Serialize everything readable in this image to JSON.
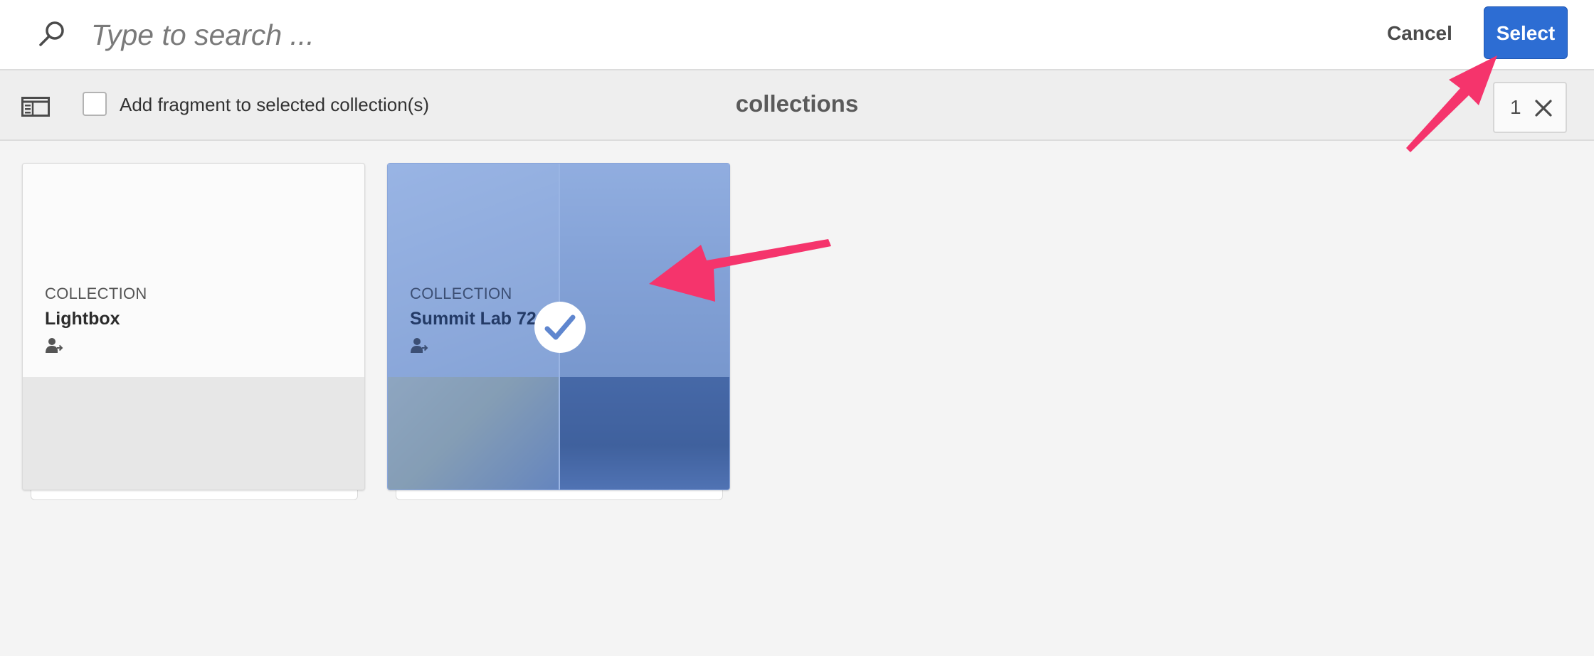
{
  "search": {
    "placeholder": "Type to search ...",
    "value": "",
    "icon": "search-icon"
  },
  "header": {
    "cancel_label": "Cancel",
    "select_label": "Select",
    "select_color": "#2d6dd3"
  },
  "toolbar": {
    "rail_icon": "rail-toggle-icon",
    "checkbox_label": "Add fragment to selected collection(s)",
    "checkbox_checked": false,
    "title": "collections",
    "selected_count": "1",
    "clear_icon": "close-icon"
  },
  "cards": [
    {
      "type": "COLLECTION",
      "title": "Lightbox",
      "icon": "user-share-icon",
      "selected": false
    },
    {
      "type": "COLLECTION",
      "title": "Summit Lab 724",
      "icon": "user-share-icon",
      "selected": true,
      "overlay_color": "#5082d7"
    }
  ],
  "annotations": {
    "arrow_color": "#f5346c"
  }
}
